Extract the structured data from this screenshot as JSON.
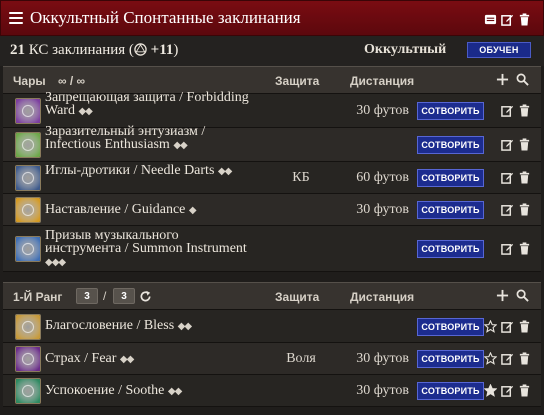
{
  "titlebar": {
    "title": "Оккультный Спонтанные заклинания",
    "icons": [
      "menu-icon",
      "preview-icon",
      "edit-icon",
      "delete-icon"
    ]
  },
  "stats": {
    "dc_value": "21",
    "dc_label": "КС заклинания",
    "attack_open": "(",
    "attack_value": "+11",
    "attack_close": ")",
    "tradition": "Оккультный",
    "badge": "ОБУЧЕН"
  },
  "cantrips": {
    "header": {
      "label": "Чары",
      "uses": "∞ / ∞",
      "col_defense": "Защита",
      "col_range": "Дистанция"
    },
    "cast_label": "СОТВОРИТЬ",
    "spells": [
      {
        "name": "Запрещающая защита / Forbidding Ward",
        "actions": "◆◆",
        "defense": "",
        "range": "30 футов",
        "icon": "forbidding-ward-icon",
        "icon_color": "#7c3fa0"
      },
      {
        "name": "Заразительный энтузиазм / Infectious Enthusiasm",
        "actions": "◆◆",
        "defense": "",
        "range": "",
        "icon": "infectious-enthusiasm-icon",
        "icon_color": "#6ea84a"
      },
      {
        "name": "Иглы-дротики / Needle Darts",
        "actions": "◆◆",
        "defense": "КБ",
        "range": "60 футов",
        "icon": "needle-darts-icon",
        "icon_color": "#3d5a8c"
      },
      {
        "name": "Наставление / Guidance",
        "actions": "◆",
        "defense": "",
        "range": "30 футов",
        "icon": "guidance-icon",
        "icon_color": "#d49a24"
      },
      {
        "name": "Призыв музыкального инструмента / Summon Instrument",
        "actions": "◆◆◆",
        "defense": "",
        "range": "",
        "icon": "summon-instrument-icon",
        "icon_color": "#3f6fb5"
      }
    ]
  },
  "rank1": {
    "header": {
      "label": "1-Й Ранг",
      "slots_current": "3",
      "slots_sep": "/",
      "slots_max": "3",
      "col_defense": "Защита",
      "col_range": "Дистанция"
    },
    "cast_label": "СОТВОРИТЬ",
    "spells": [
      {
        "name": "Благословение / Bless",
        "actions": "◆◆",
        "defense": "",
        "range": "",
        "icon": "bless-icon",
        "icon_color": "#c79a3a",
        "starred": false
      },
      {
        "name": "Страх / Fear",
        "actions": "◆◆",
        "defense": "Воля",
        "range": "30 футов",
        "icon": "fear-icon",
        "icon_color": "#6a2c8a",
        "starred": false
      },
      {
        "name": "Успокоение / Soothe",
        "actions": "◆◆",
        "defense": "",
        "range": "30 футов",
        "icon": "soothe-icon",
        "icon_color": "#2f8a62",
        "starred": true
      }
    ]
  }
}
